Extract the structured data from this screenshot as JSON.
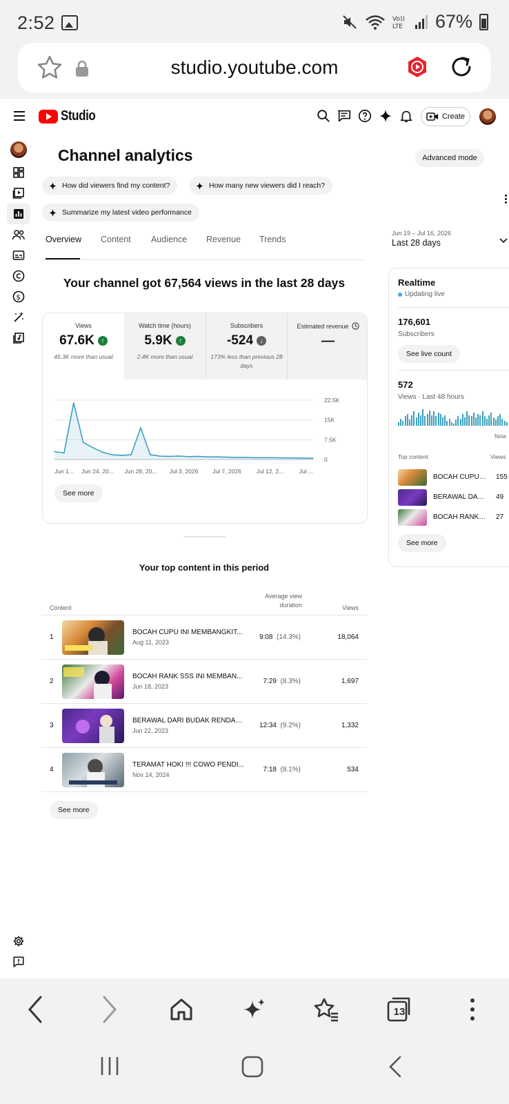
{
  "status_bar": {
    "time": "2:52",
    "battery": "67%"
  },
  "browser": {
    "url": "studio.youtube.com",
    "tab_count": "13"
  },
  "header": {
    "brand": "Studio",
    "create_label": "Create"
  },
  "page": {
    "title": "Channel analytics",
    "advanced_mode": "Advanced mode",
    "chips": [
      "How did viewers find my content?",
      "How many new viewers did I reach?",
      "Summarize my latest video performance"
    ],
    "tabs": [
      "Overview",
      "Content",
      "Audience",
      "Revenue",
      "Trends"
    ],
    "active_tab": "Overview",
    "date_range": {
      "dates": "Jun 19 – Jul 16, 2026",
      "label": "Last 28 days"
    },
    "headline": "Your channel got 67,564 views in the last 28 days"
  },
  "metrics": [
    {
      "label": "Views",
      "value": "67.6K",
      "trend": "up",
      "sub": "45.3K more than usual"
    },
    {
      "label": "Watch time (hours)",
      "value": "5.9K",
      "trend": "up",
      "sub": "2.4K more than usual"
    },
    {
      "label": "Subscribers",
      "value": "-524",
      "trend": "down",
      "sub": "173% less than previous 28 days"
    },
    {
      "label": "Estimated revenue",
      "value": "—",
      "trend": "none",
      "sub": ""
    }
  ],
  "chart_data": {
    "type": "area",
    "x_labels": [
      "Jun 1...",
      "Jun 24, 20...",
      "Jun 28, 20...",
      "Jul 3, 2026",
      "Jul 7, 2026",
      "Jul 12, 2...",
      "Jul ..."
    ],
    "y_ticks": [
      "22.5K",
      "15K",
      "7.5K",
      "0"
    ],
    "ylim": [
      0,
      22500
    ],
    "values": [
      3000,
      2500,
      21500,
      6500,
      4500,
      2800,
      1800,
      1600,
      1800,
      12000,
      1800,
      1300,
      1200,
      1300,
      1100,
      1200,
      1000,
      1000,
      900,
      800,
      800,
      700,
      700,
      700,
      600,
      600,
      500,
      500
    ],
    "color": "#3b9fc0",
    "grid": true
  },
  "chart_see_more": "See more",
  "top_content": {
    "title": "Your top content in this period",
    "columns": {
      "content": "Content",
      "avd": "Average view duration",
      "views": "Views"
    },
    "rows": [
      {
        "rank": "1",
        "title": "BOCAH CUPU INI MEMBANGKIT...",
        "date": "Aug 11, 2023",
        "duration": "9:08",
        "pct": "(14.3%)",
        "views": "18,064"
      },
      {
        "rank": "2",
        "title": "BOCAH RANK SSS INI MEMBAN...",
        "date": "Jun 18, 2023",
        "duration": "7:29",
        "pct": "(8.3%)",
        "views": "1,697"
      },
      {
        "rank": "3",
        "title": "BERAWAL DARI BUDAK RENDAH...",
        "date": "Jun 22, 2023",
        "duration": "12:34",
        "pct": "(9.2%)",
        "views": "1,332"
      },
      {
        "rank": "4",
        "title": "TERAMAT HOKI !!! COWO PENDI...",
        "date": "Nov 14, 2024",
        "duration": "7:18",
        "pct": "(8.1%)",
        "views": "534"
      }
    ],
    "see_more": "See more"
  },
  "realtime": {
    "title": "Realtime",
    "status": "Updating live",
    "subscribers": "176,601",
    "subscribers_label": "Subscribers",
    "see_live_count": "See live count",
    "views": "572",
    "views_label": "Views · Last 48 hours",
    "now_label": "Now",
    "top_content_label": "Top content",
    "views_col_label": "Views",
    "items": [
      {
        "title": "BOCAH CUPU INI MEMBANGKIT",
        "views": "155"
      },
      {
        "title": "BERAWAL DARI BUDAK RENDAH",
        "views": "49"
      },
      {
        "title": "BOCAH RANK SSS INI MEMBAN",
        "views": "27"
      }
    ],
    "bars": [
      3,
      6,
      4,
      8,
      10,
      5,
      9,
      12,
      7,
      11,
      9,
      14,
      8,
      10,
      13,
      9,
      12,
      8,
      11,
      10,
      7,
      9,
      4,
      6,
      3,
      2,
      5,
      8,
      6,
      10,
      7,
      12,
      9,
      8,
      11,
      7,
      10,
      9,
      12,
      8,
      6,
      9,
      11,
      7,
      5,
      8,
      10,
      6,
      4,
      3
    ],
    "see_more": "See more"
  }
}
